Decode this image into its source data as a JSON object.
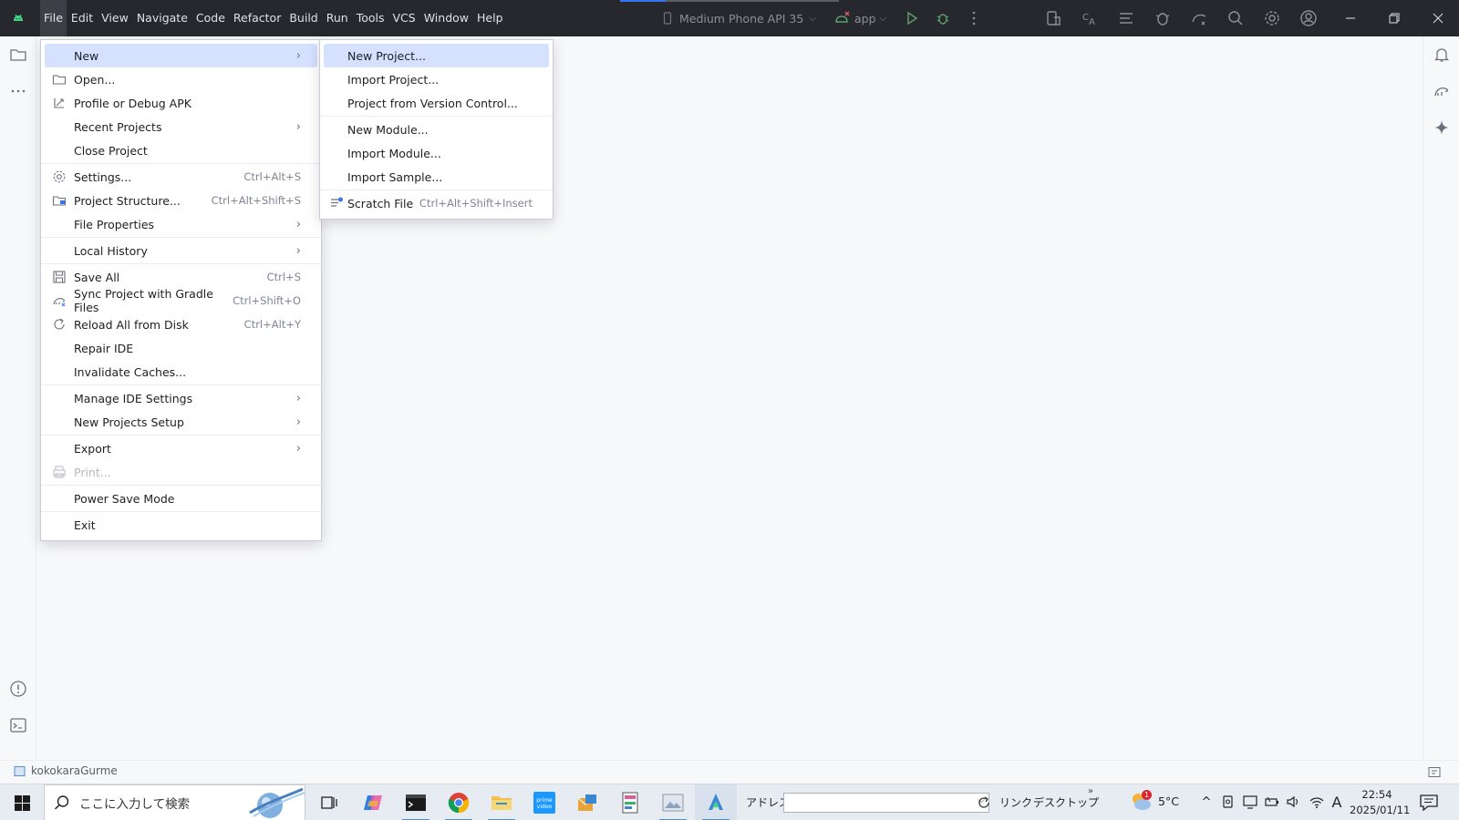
{
  "menubar": {
    "items": [
      "File",
      "Edit",
      "View",
      "Navigate",
      "Code",
      "Refactor",
      "Build",
      "Run",
      "Tools",
      "VCS",
      "Window",
      "Help"
    ],
    "active": "File"
  },
  "toolbar": {
    "device": "Medium Phone API 35",
    "run_config": "app"
  },
  "file_menu": {
    "items": [
      {
        "label": "New",
        "submenu": true,
        "highlighted": true,
        "icon": ""
      },
      {
        "label": "Open...",
        "icon": "folder-icon"
      },
      {
        "label": "Profile or Debug APK",
        "icon": "profile-apk-icon"
      },
      {
        "label": "Recent Projects",
        "submenu": true
      },
      {
        "label": "Close Project"
      },
      {
        "separator": true
      },
      {
        "label": "Settings...",
        "shortcut": "Ctrl+Alt+S",
        "icon": "gear-icon"
      },
      {
        "label": "Project Structure...",
        "shortcut": "Ctrl+Alt+Shift+S",
        "icon": "project-structure-icon"
      },
      {
        "label": "File Properties",
        "submenu": true
      },
      {
        "separator": true
      },
      {
        "label": "Local History",
        "submenu": true
      },
      {
        "separator": true
      },
      {
        "label": "Save All",
        "shortcut": "Ctrl+S",
        "icon": "save-icon"
      },
      {
        "label": "Sync Project with Gradle Files",
        "shortcut": "Ctrl+Shift+O",
        "icon": "gradle-sync-icon"
      },
      {
        "label": "Reload All from Disk",
        "shortcut": "Ctrl+Alt+Y",
        "icon": "reload-icon"
      },
      {
        "label": "Repair IDE"
      },
      {
        "label": "Invalidate Caches..."
      },
      {
        "separator": true
      },
      {
        "label": "Manage IDE Settings",
        "submenu": true
      },
      {
        "label": "New Projects Setup",
        "submenu": true
      },
      {
        "separator": true
      },
      {
        "label": "Export",
        "submenu": true
      },
      {
        "label": "Print...",
        "disabled": true,
        "icon": "print-icon"
      },
      {
        "separator": true
      },
      {
        "label": "Power Save Mode"
      },
      {
        "separator": true
      },
      {
        "label": "Exit"
      }
    ]
  },
  "new_submenu": {
    "items": [
      {
        "label": "New Project...",
        "highlighted": true
      },
      {
        "label": "Import Project..."
      },
      {
        "label": "Project from Version Control..."
      },
      {
        "separator": true
      },
      {
        "label": "New Module..."
      },
      {
        "label": "Import Module..."
      },
      {
        "label": "Import Sample..."
      },
      {
        "separator": true
      },
      {
        "label": "Scratch File",
        "shortcut": "Ctrl+Alt+Shift+Insert",
        "icon": "scratch-file-icon"
      }
    ]
  },
  "statusbar": {
    "project_name": "kokokaraGurme"
  },
  "taskbar": {
    "search_placeholder": "ここに入力して検索",
    "address_label": "アドレス",
    "link_label": "リンク",
    "desktop_label": "デスクトップ",
    "weather_temp": "5°C",
    "weather_badge": "1",
    "time": "22:54",
    "date": "2025/01/11",
    "ime": "A"
  },
  "colors": {
    "titlebar_bg": "#27282e",
    "menu_highlight": "#d5e1ff",
    "accent": "#3574f0"
  }
}
